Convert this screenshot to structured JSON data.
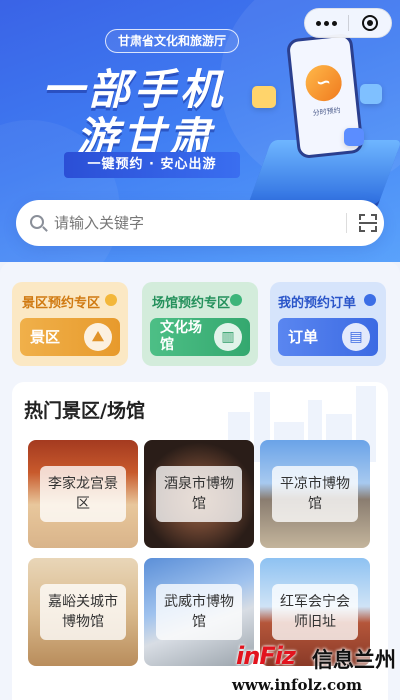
{
  "banner": {
    "agency": "甘肃省文化和旅游厅",
    "headline_line1": "一部手机",
    "headline_line2": "游甘肃",
    "slogan": "一键预约 · 安心出游",
    "phone_caption": "分时预约"
  },
  "search": {
    "placeholder": "请输入关键字"
  },
  "zones": {
    "scenic": {
      "title": "景区预约专区",
      "button": "景区",
      "icon": "scenic-mountain-icon",
      "color": "#e79a2c"
    },
    "venue": {
      "title": "场馆预约专区",
      "button": "文化场馆",
      "icon": "building-icon",
      "color": "#34a86f"
    },
    "mine": {
      "title": "我的预约订单",
      "button": "订单",
      "icon": "order-document-icon",
      "color": "#3b6ae3"
    }
  },
  "hot": {
    "title": "热门景区/场馆",
    "items": [
      {
        "name": "李家龙宫景区"
      },
      {
        "name": "酒泉市博物馆"
      },
      {
        "name": "平凉市博物馆"
      },
      {
        "name": "嘉峪关城市博物馆"
      },
      {
        "name": "武威市博物馆"
      },
      {
        "name": "红军会宁会师旧址"
      }
    ]
  },
  "watermark": {
    "logo": "inFiz",
    "name": "信息兰州",
    "url": "www.infolz.com"
  },
  "colors": {
    "banner_blue": "#3f7cf2",
    "accent_red": "#e2141e"
  }
}
